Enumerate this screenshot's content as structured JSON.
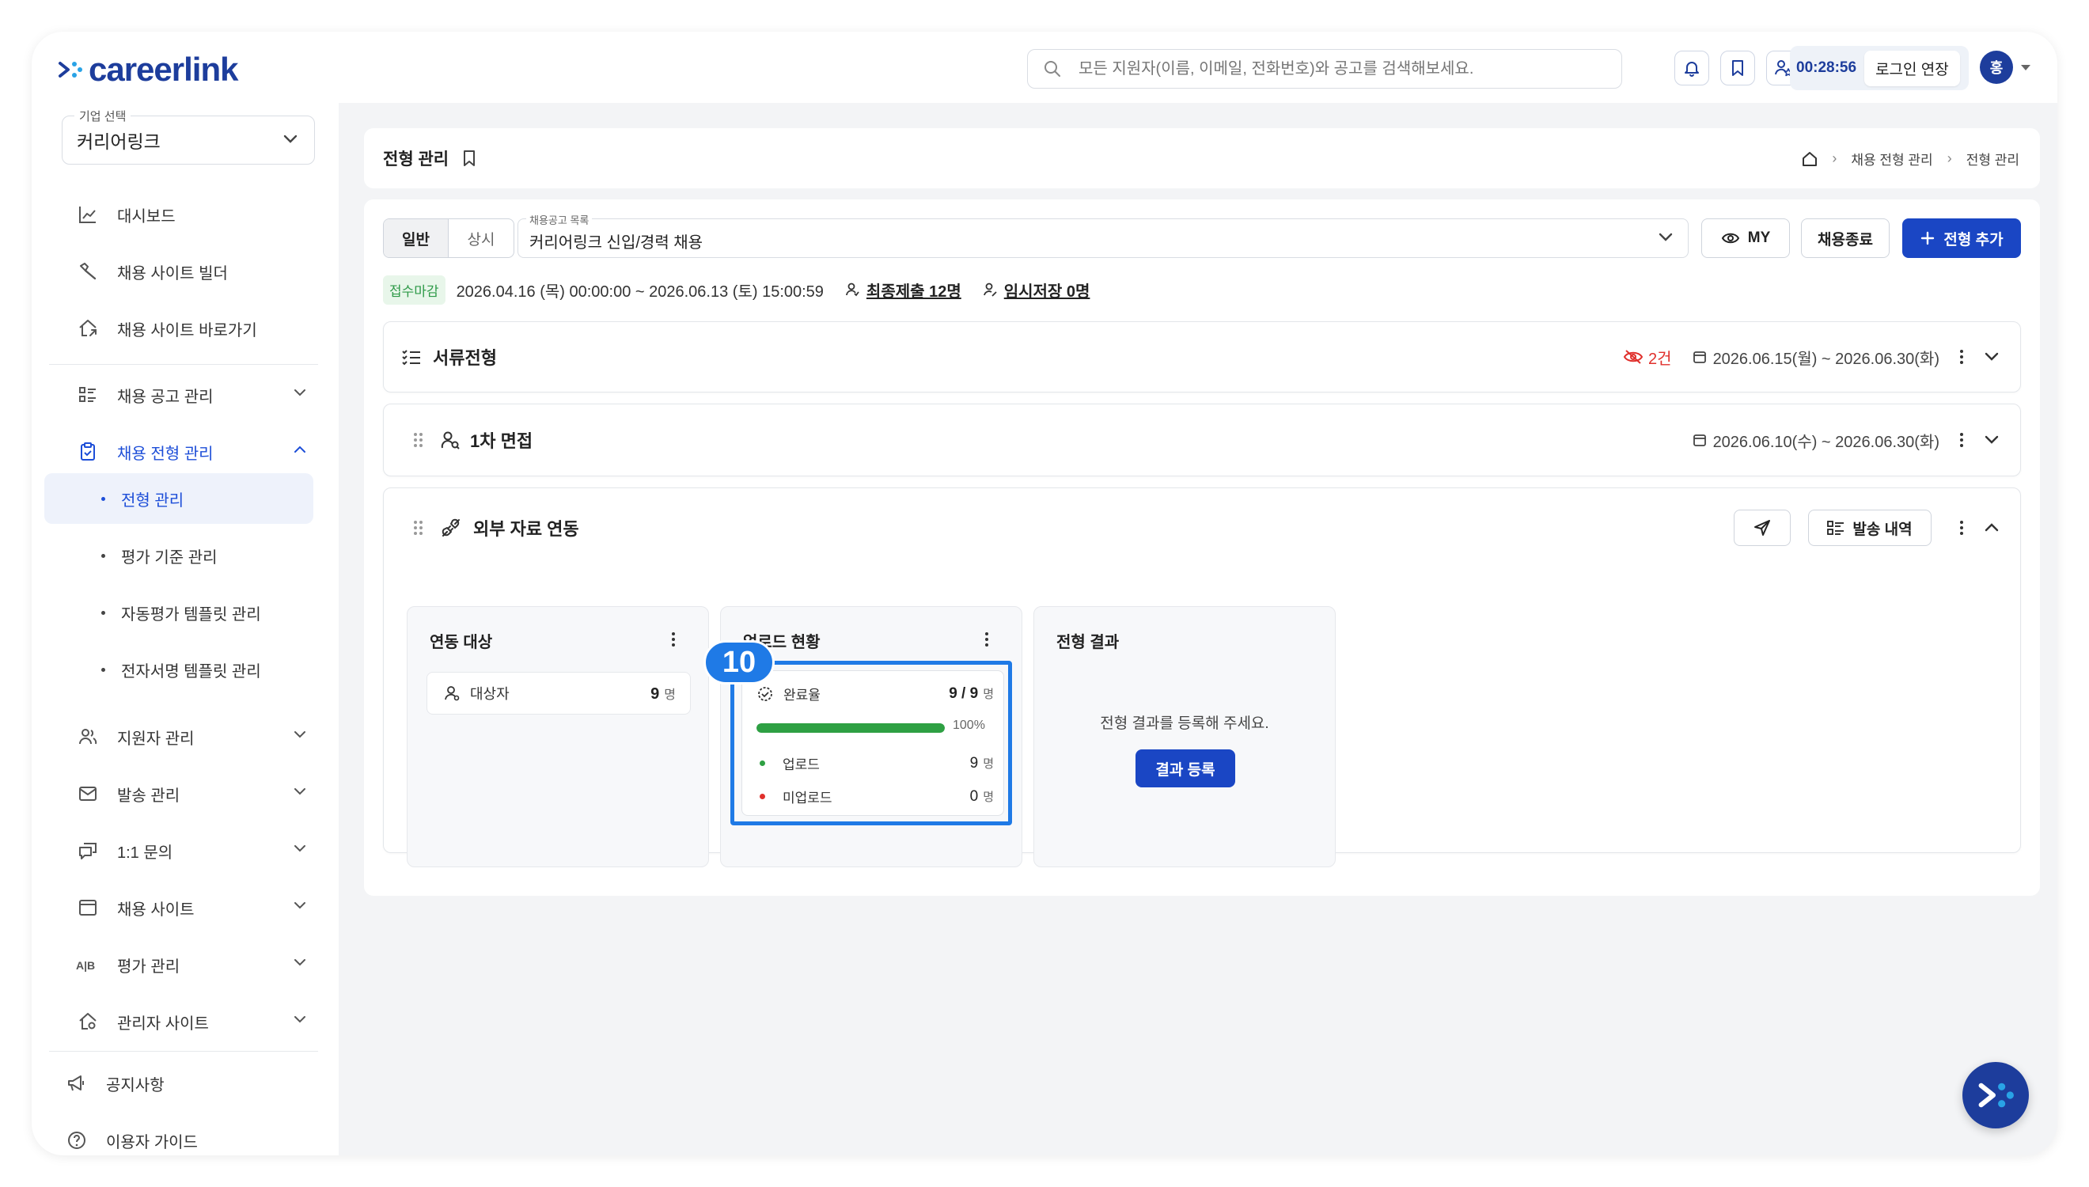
{
  "brand": {
    "name": "careerlink",
    "color": "#1d3d9c",
    "accent": "#1a46c4"
  },
  "header": {
    "search_placeholder": "모든 지원자(이름, 이메일, 전화번호)와 공고를 검색해보세요.",
    "icons": [
      "bell-icon",
      "bookmark-icon",
      "user-star-icon"
    ],
    "timer": "00:28:56",
    "extend_label": "로그인 연장",
    "avatar_initial": "홍"
  },
  "sidebar": {
    "company_label": "기업 선택",
    "company_value": "커리어링크",
    "items": [
      {
        "label": "대시보드",
        "icon": "chart-icon"
      },
      {
        "label": "채용 사이트 빌더",
        "icon": "tools-icon"
      },
      {
        "label": "채용 사이트 바로가기",
        "icon": "home-link-icon"
      },
      {
        "label": "채용 공고 관리",
        "icon": "list-icon"
      },
      {
        "label": "채용 전형 관리",
        "icon": "clipboard-icon"
      },
      {
        "label": "지원자 관리",
        "icon": "users-icon"
      },
      {
        "label": "발송 관리",
        "icon": "mail-icon"
      },
      {
        "label": "1:1 문의",
        "icon": "chat-icon"
      },
      {
        "label": "채용 사이트",
        "icon": "window-icon"
      },
      {
        "label": "평가 관리",
        "icon": "ab-icon"
      },
      {
        "label": "관리자 사이트",
        "icon": "admin-home-icon"
      }
    ],
    "sub_items": [
      "전형 관리",
      "평가 기준 관리",
      "자동평가 템플릿 관리",
      "전자서명 템플릿 관리"
    ],
    "footer": [
      {
        "label": "공지사항",
        "icon": "megaphone-icon"
      },
      {
        "label": "이용자 가이드",
        "icon": "help-icon"
      }
    ]
  },
  "page": {
    "title": "전형 관리",
    "breadcrumb": [
      "채용 전형 관리",
      "전형 관리"
    ]
  },
  "toolbar": {
    "tabs": [
      "일반",
      "상시"
    ],
    "job_list_label": "채용공고 목록",
    "job_selected": "커리어링크 신입/경력 채용",
    "my_label": "MY",
    "close_label": "채용종료",
    "add_label": "전형 추가"
  },
  "status": {
    "badge": "접수마감",
    "period": "2026.04.16 (목) 00:00:00 ~ 2026.06.13 (토) 15:00:59",
    "final_submit": "최종제출 12명",
    "temp_save": "임시저장 0명"
  },
  "stages": [
    {
      "title": "서류전형",
      "hidden_count": "2건",
      "period": "2026.06.15(월) ~ 2026.06.30(화)"
    },
    {
      "title": "1차 면접",
      "period": "2026.06.10(수) ~ 2026.06.30(화)"
    },
    {
      "title": "외부 자료 연동",
      "history_label": "발송 내역"
    }
  ],
  "panels": {
    "target": {
      "title": "연동 대상",
      "row_label": "대상자",
      "value": "9",
      "unit": "명"
    },
    "upload": {
      "title": "업로드 현황",
      "rate_label": "완료율",
      "rate_value": "9 / 9",
      "rate_unit": "명",
      "progress": 1.0,
      "progress_text": "100%",
      "uploaded_label": "업로드",
      "uploaded_value": "9",
      "not_uploaded_label": "미업로드",
      "not_uploaded_value": "0",
      "unit": "명"
    },
    "result": {
      "title": "전형 결과",
      "message": "전형 결과를 등록해 주세요.",
      "button": "결과 등록"
    }
  },
  "annotation": {
    "step_number": "10",
    "color": "#1f7ae6"
  }
}
